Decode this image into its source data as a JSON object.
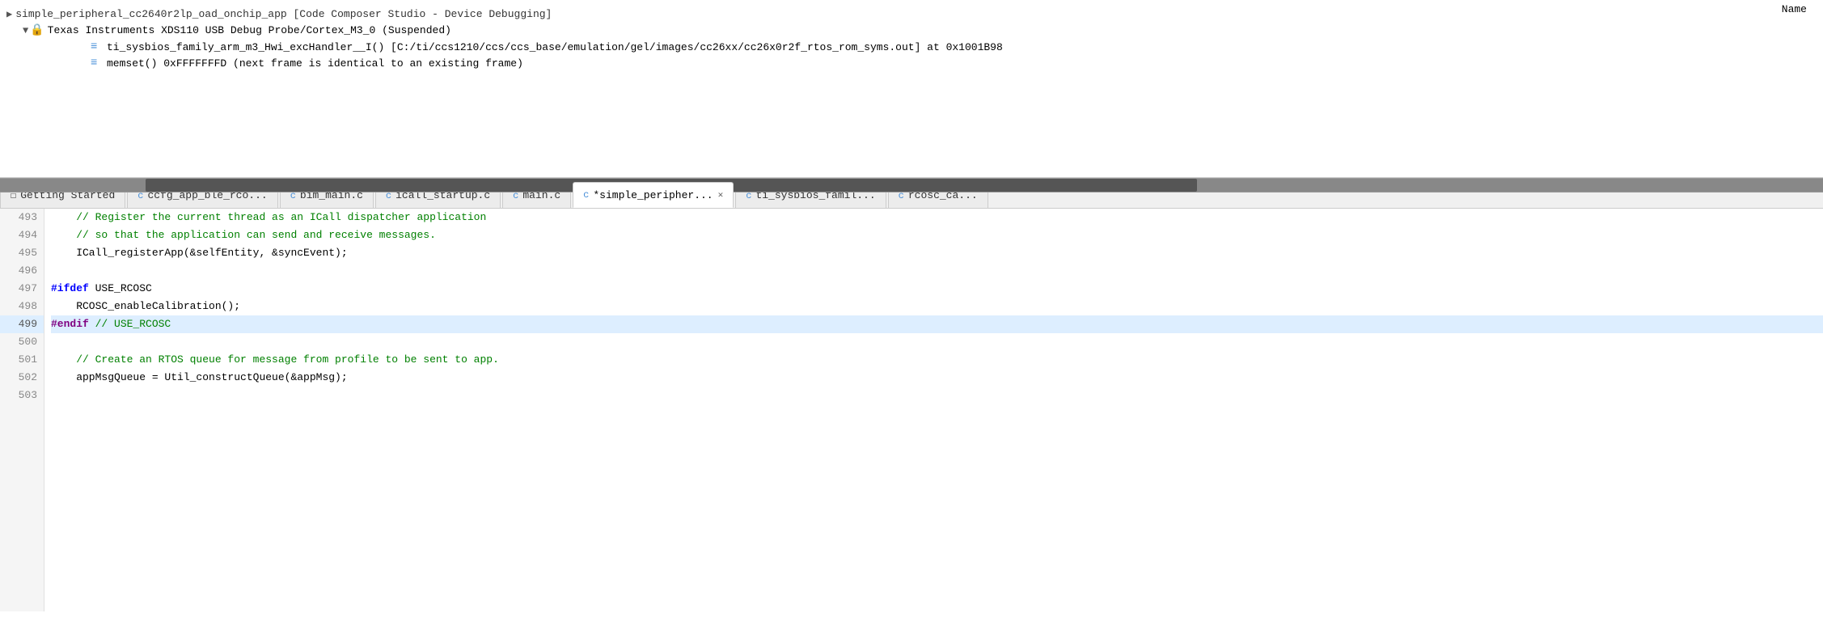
{
  "debug_panel": {
    "title": "simple_peripheral_cc2640r2lp_oad_onchip_app [Code Composer Studio - Device Debugging]",
    "name_col_label": "Name",
    "tree": {
      "root_label": "simple_peripheral_cc2640r2lp_oad_onchip_app [Code Composer Studio - Device Debugging]",
      "suspended_label": "Texas Instruments XDS110 USB Debug Probe/Cortex_M3_0 (Suspended)",
      "frame1_label": "ti_sysbios_family_arm_m3_Hwi_excHandler__I() [C:/ti/ccs1210/ccs/ccs_base/emulation/gel/images/cc26xx/cc26x0r2f_rtos_rom_syms.out] at 0x1001B98",
      "frame2_label": "memset() 0xFFFFFFFD  (next frame is identical to an existing frame)"
    }
  },
  "tabs": [
    {
      "id": "getting-started",
      "label": "Getting Started",
      "icon": "page",
      "active": false,
      "closeable": false
    },
    {
      "id": "ccfg",
      "label": "ccfg_app_ble_rco...",
      "icon": "c-file",
      "active": false,
      "closeable": false
    },
    {
      "id": "bim-main",
      "label": "bim_main.c",
      "icon": "c-file",
      "active": false,
      "closeable": false
    },
    {
      "id": "icall-startup",
      "label": "icall_startup.c",
      "icon": "c-file",
      "active": false,
      "closeable": false
    },
    {
      "id": "main",
      "label": "main.c",
      "icon": "c-file",
      "active": false,
      "closeable": false
    },
    {
      "id": "simple-periph",
      "label": "*simple_peripher...",
      "icon": "c-file",
      "active": true,
      "closeable": true
    },
    {
      "id": "ti-sysbios",
      "label": "ti_sysbios_famil...",
      "icon": "c-file",
      "active": false,
      "closeable": false
    },
    {
      "id": "rcosc-ca",
      "label": "rcosc_ca...",
      "icon": "c-file",
      "active": false,
      "closeable": false
    }
  ],
  "code": {
    "lines": [
      {
        "number": "493",
        "content": "    // Register the current thread as an ICall dispatcher application",
        "type": "comment",
        "highlighted": false
      },
      {
        "number": "494",
        "content": "    // so that the application can send and receive messages.",
        "type": "comment",
        "highlighted": false
      },
      {
        "number": "495",
        "content": "    ICall_registerApp(&selfEntity, &syncEvent);",
        "type": "normal",
        "highlighted": false
      },
      {
        "number": "496",
        "content": "",
        "type": "empty",
        "highlighted": false
      },
      {
        "number": "497",
        "content": "#ifdef USE_RCOSC",
        "type": "ifdef",
        "highlighted": false
      },
      {
        "number": "498",
        "content": "    RCOSC_enableCalibration();",
        "type": "normal",
        "highlighted": false
      },
      {
        "number": "499",
        "content": "#endif // USE_RCOSC",
        "type": "endif",
        "highlighted": true
      },
      {
        "number": "500",
        "content": "",
        "type": "empty",
        "highlighted": false
      },
      {
        "number": "501",
        "content": "    // Create an RTOS queue for message from profile to be sent to app.",
        "type": "comment",
        "highlighted": false
      },
      {
        "number": "502",
        "content": "    appMsgQueue = Util_constructQueue(&appMsg);",
        "type": "normal",
        "highlighted": false
      },
      {
        "number": "503",
        "content": "",
        "type": "ellipsis",
        "highlighted": false
      }
    ]
  }
}
